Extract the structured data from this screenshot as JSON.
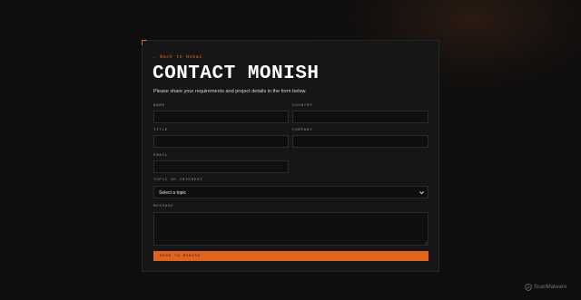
{
  "form": {
    "back_label": "← Back to Hokai",
    "title": "CONTACT MONISH",
    "subtitle": "Please share your requirements and project details in the form below.",
    "fields": {
      "name": {
        "label": "NAME",
        "value": ""
      },
      "country": {
        "label": "COUNTRY",
        "value": ""
      },
      "title": {
        "label": "TITLE",
        "value": ""
      },
      "company": {
        "label": "COMPANY",
        "value": ""
      },
      "email": {
        "label": "EMAIL",
        "value": ""
      },
      "topic": {
        "label": "TOPIC OF INTEREST",
        "selected": "Select a topic"
      },
      "message": {
        "label": "MESSAGE",
        "value": ""
      }
    },
    "submit_label": "SEND TO MONISH"
  },
  "watermark": {
    "text": "ScanMalware"
  },
  "colors": {
    "accent": "#e0641e",
    "card": "#161616",
    "background": "#0e0e0e"
  }
}
